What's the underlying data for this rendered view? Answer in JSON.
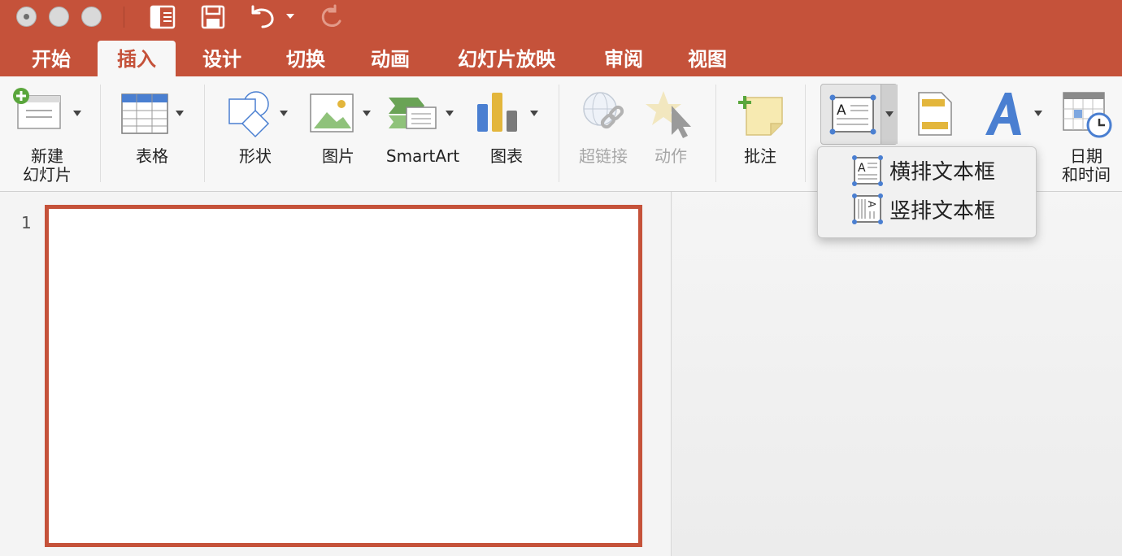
{
  "titlebar": {
    "window_buttons": [
      "close",
      "minimize",
      "zoom"
    ],
    "tools": [
      "sidebar-icon",
      "save-icon",
      "undo-icon",
      "undo-dropdown-icon",
      "redo-icon"
    ]
  },
  "tabs": [
    {
      "label": "开始",
      "active": false
    },
    {
      "label": "插入",
      "active": true
    },
    {
      "label": "设计",
      "active": false
    },
    {
      "label": "切换",
      "active": false
    },
    {
      "label": "动画",
      "active": false
    },
    {
      "label": "幻灯片放映",
      "active": false
    },
    {
      "label": "审阅",
      "active": false
    },
    {
      "label": "视图",
      "active": false
    }
  ],
  "ribbon": {
    "new_slide": {
      "line1": "新建",
      "line2": "幻灯片"
    },
    "table": "表格",
    "shapes": "形状",
    "pictures": "图片",
    "smartart": "SmartArt",
    "chart": "图表",
    "hyperlink": "超链接",
    "action": "动作",
    "comment": "批注",
    "datetime": {
      "line1": "日期",
      "line2": "和时间"
    }
  },
  "textbox_menu": {
    "items": [
      {
        "label": "横排文本框",
        "icon": "horizontal-textbox-icon"
      },
      {
        "label": "竖排文本框",
        "icon": "vertical-textbox-icon"
      }
    ]
  },
  "slides": {
    "current_number": "1"
  },
  "colors": {
    "accent": "#c5523a",
    "ribbon_bg": "#f7f7f7"
  }
}
